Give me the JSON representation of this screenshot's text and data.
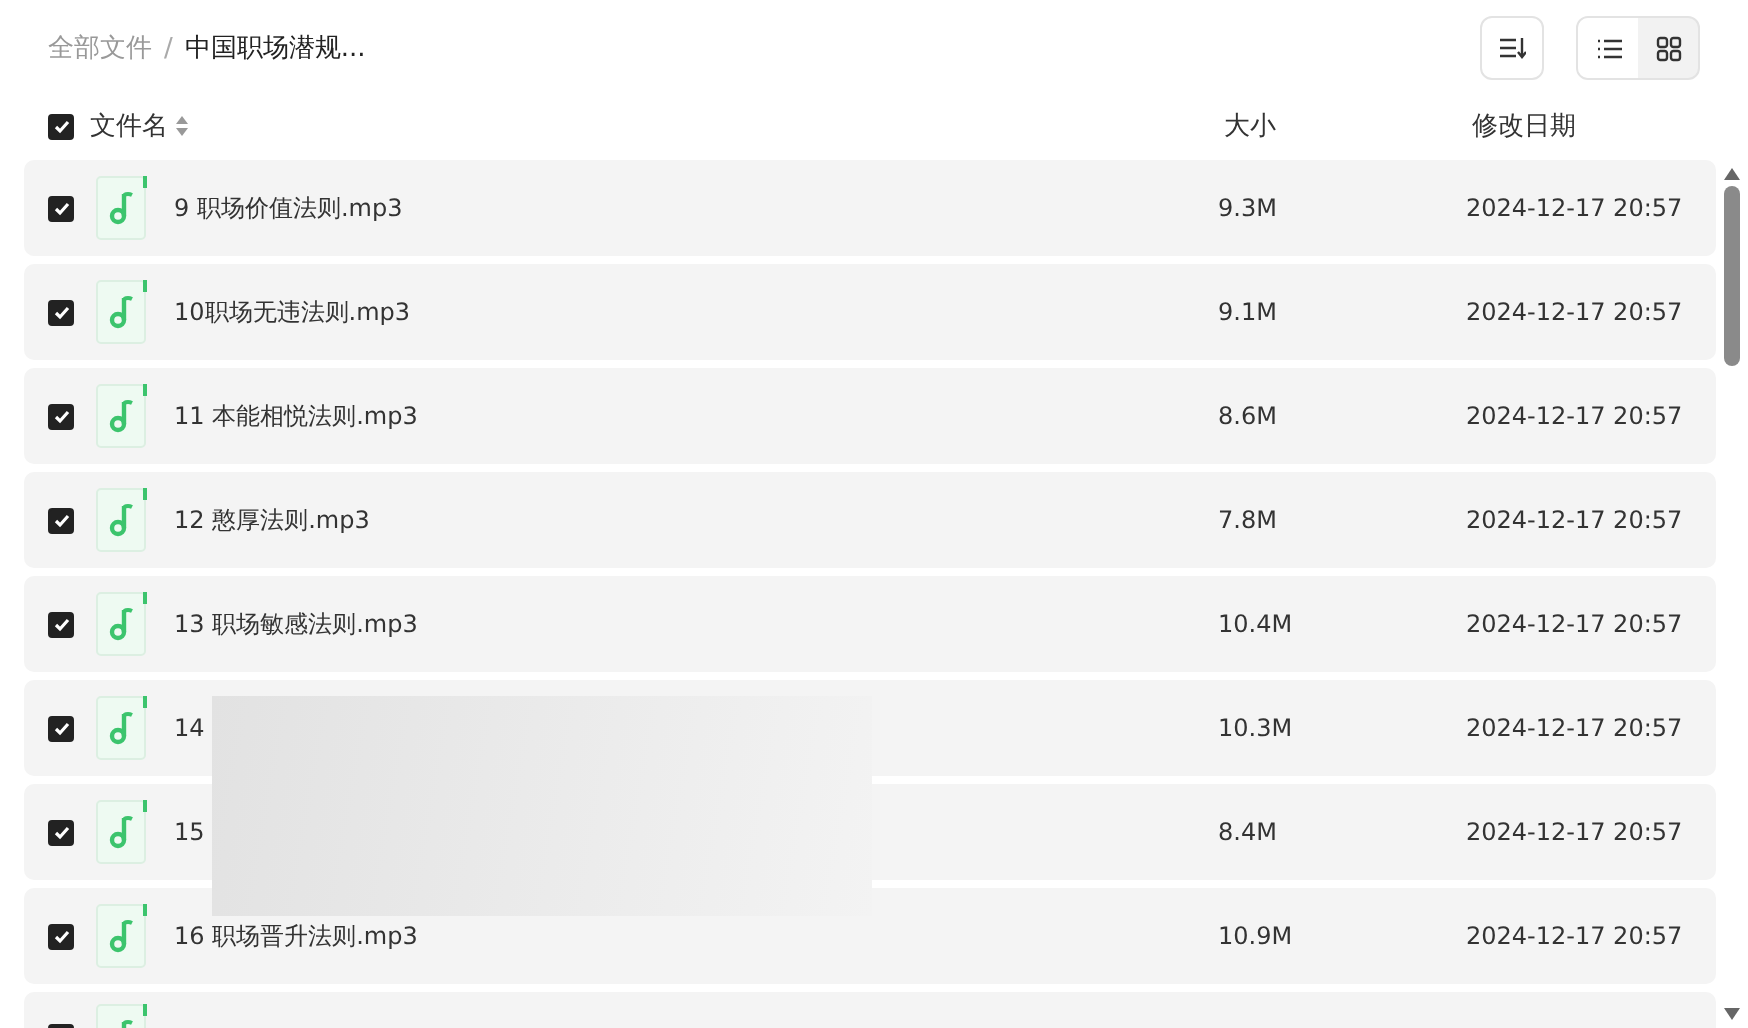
{
  "breadcrumb": [
    {
      "label": "全部文件",
      "current": false
    },
    {
      "label": "中国职场潜规...",
      "current": true
    }
  ],
  "breadcrumb_separator": "/",
  "view_toggle": [
    {
      "kind": "list",
      "selected": true
    },
    {
      "kind": "grid",
      "selected": false
    }
  ],
  "table": {
    "all_checked": true,
    "columns": [
      "文件名",
      "大小",
      "修改日期"
    ],
    "rows": [
      {
        "checked": true,
        "name": "9 职场价值法则.mp3",
        "size": "9.3M",
        "modified": "2024-12-17 20:57"
      },
      {
        "checked": true,
        "name": "10职场无违法则.mp3",
        "size": "9.1M",
        "modified": "2024-12-17 20:57"
      },
      {
        "checked": true,
        "name": "11 本能相悦法则.mp3",
        "size": "8.6M",
        "modified": "2024-12-17 20:57"
      },
      {
        "checked": true,
        "name": "12 憨厚法则.mp3",
        "size": "7.8M",
        "modified": "2024-12-17 20:57"
      },
      {
        "checked": true,
        "name": "13 职场敏感法则.mp3",
        "size": "10.4M",
        "modified": "2024-12-17 20:57"
      },
      {
        "checked": true,
        "name": "14",
        "size": "10.3M",
        "modified": "2024-12-17 20:57"
      },
      {
        "checked": true,
        "name": "15",
        "size": "8.4M",
        "modified": "2024-12-17 20:57"
      },
      {
        "checked": true,
        "name": "16 职场晋升法则.mp3",
        "size": "10.9M",
        "modified": "2024-12-17 20:57"
      },
      {
        "checked": true
      }
    ]
  }
}
